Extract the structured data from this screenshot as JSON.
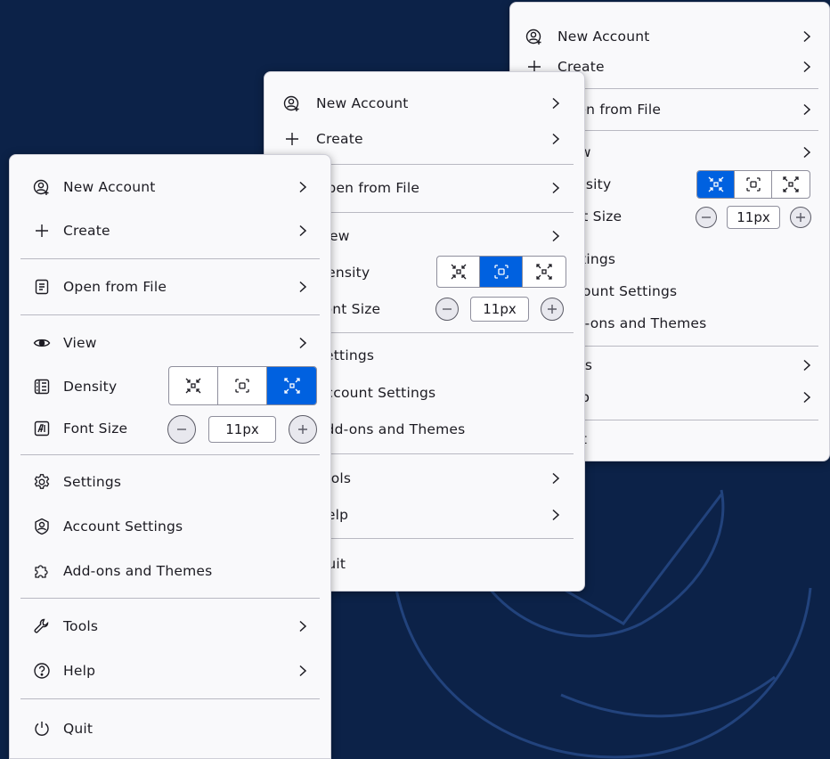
{
  "menu": {
    "new_account": "New Account",
    "create": "Create",
    "open_from_file": "Open from File",
    "view": "View",
    "density": "Density",
    "font_size": "Font Size",
    "font_size_value": "11px",
    "settings": "Settings",
    "account_settings": "Account Settings",
    "addons_themes": "Add-ons and Themes",
    "tools": "Tools",
    "help": "Help",
    "quit": "Quit"
  },
  "states": {
    "front_density_selected": "relaxed",
    "middle_density_selected": "normal",
    "back_density_selected": "compact"
  },
  "colors": {
    "background": "#0c2248",
    "menu_bg": "#f9f9fb",
    "accent": "#0061e0",
    "text": "#1c1b22"
  }
}
